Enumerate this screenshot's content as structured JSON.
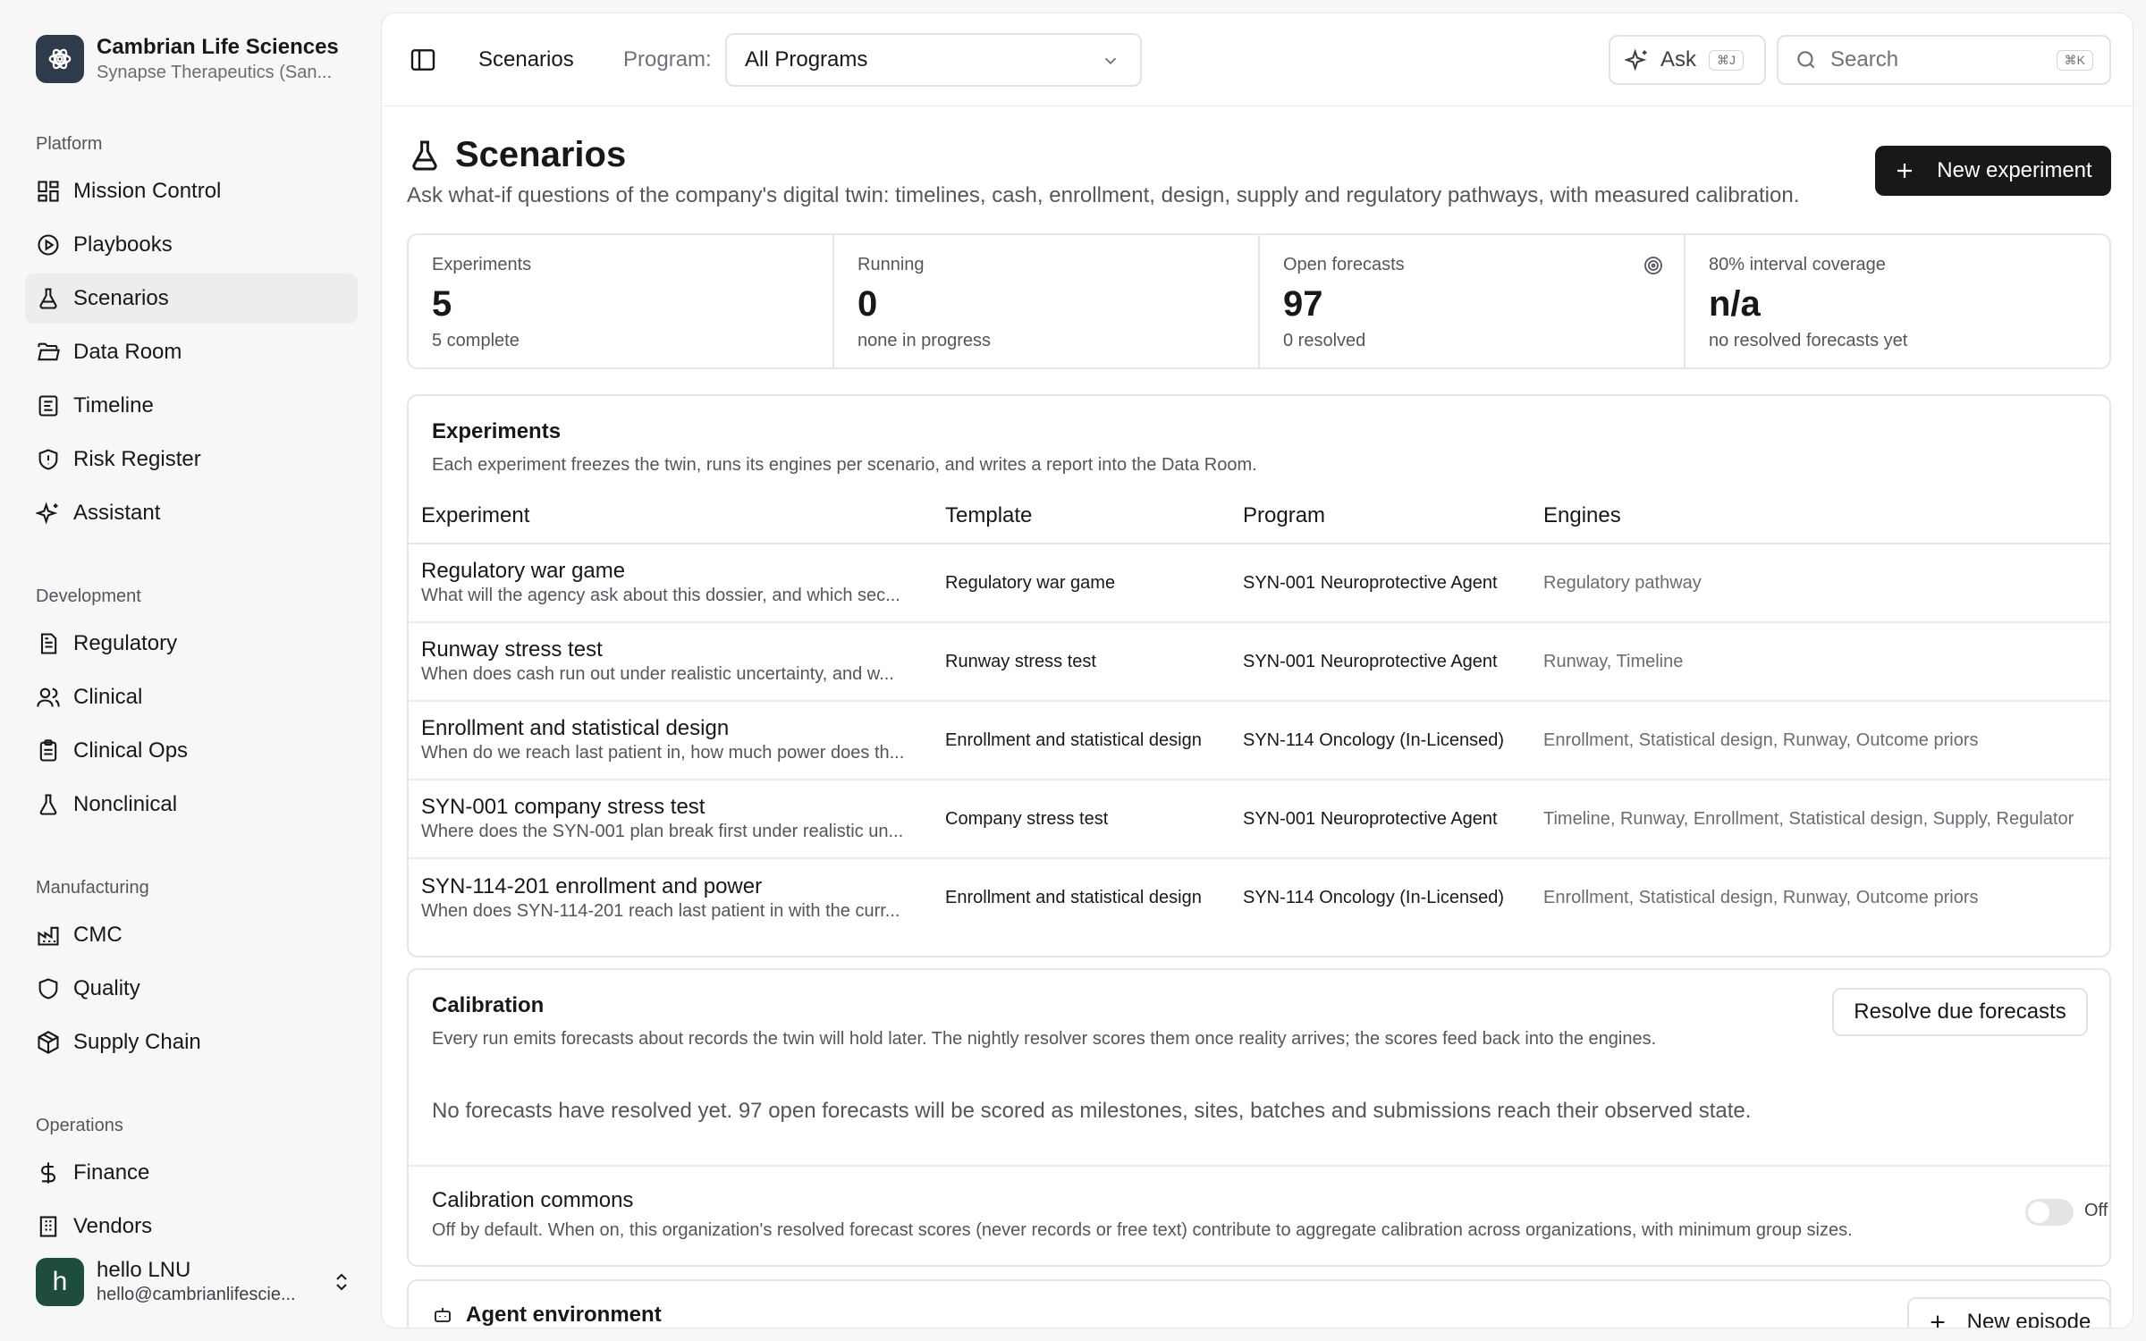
{
  "org": {
    "name": "Cambrian Life Sciences",
    "subtitle": "Synapse Therapeutics (San..."
  },
  "sidebar": {
    "sections": [
      {
        "heading": "Platform",
        "items": [
          {
            "label": "Mission Control",
            "icon": "dashboard-icon"
          },
          {
            "label": "Playbooks",
            "icon": "play-circle-icon"
          },
          {
            "label": "Scenarios",
            "icon": "flask-icon",
            "active": true
          },
          {
            "label": "Data Room",
            "icon": "folder-open-icon"
          },
          {
            "label": "Timeline",
            "icon": "timeline-icon"
          },
          {
            "label": "Risk Register",
            "icon": "shield-alert-icon"
          },
          {
            "label": "Assistant",
            "icon": "sparkles-icon"
          }
        ]
      },
      {
        "heading": "Development",
        "items": [
          {
            "label": "Regulatory",
            "icon": "document-icon"
          },
          {
            "label": "Clinical",
            "icon": "users-icon"
          },
          {
            "label": "Clinical Ops",
            "icon": "clipboard-icon"
          },
          {
            "label": "Nonclinical",
            "icon": "beaker-icon"
          }
        ]
      },
      {
        "heading": "Manufacturing",
        "items": [
          {
            "label": "CMC",
            "icon": "factory-icon"
          },
          {
            "label": "Quality",
            "icon": "shield-icon"
          },
          {
            "label": "Supply Chain",
            "icon": "package-icon"
          }
        ]
      },
      {
        "heading": "Operations",
        "items": [
          {
            "label": "Finance",
            "icon": "dollar-icon"
          },
          {
            "label": "Vendors",
            "icon": "building-icon"
          }
        ]
      }
    ]
  },
  "user": {
    "initial": "h",
    "name": "hello LNU",
    "email": "hello@cambrianlifescie..."
  },
  "topbar": {
    "crumb": "Scenarios",
    "program_label": "Program:",
    "program_value": "All Programs",
    "ask_label": "Ask",
    "ask_kbd": "⌘J",
    "search_placeholder": "Search",
    "search_kbd": "⌘K"
  },
  "page": {
    "title": "Scenarios",
    "description": "Ask what-if questions of the company's digital twin: timelines, cash, enrollment, design, supply and regulatory pathways, with measured calibration.",
    "new_experiment": "New experiment"
  },
  "stats": [
    {
      "label": "Experiments",
      "value": "5",
      "sub": "5 complete"
    },
    {
      "label": "Running",
      "value": "0",
      "sub": "none in progress"
    },
    {
      "label": "Open forecasts",
      "value": "97",
      "sub": "0 resolved"
    },
    {
      "label": "80% interval coverage",
      "value": "n/a",
      "sub": "no resolved forecasts yet"
    }
  ],
  "experiments": {
    "title": "Experiments",
    "subtitle": "Each experiment freezes the twin, runs its engines per scenario, and writes a report into the Data Room.",
    "columns": [
      "Experiment",
      "Template",
      "Program",
      "Engines"
    ],
    "rows": [
      {
        "name": "Regulatory war game",
        "desc": "What will the agency ask about this dossier, and which sec...",
        "template": "Regulatory war game",
        "program": "SYN-001 Neuroprotective Agent",
        "engines": "Regulatory pathway"
      },
      {
        "name": "Runway stress test",
        "desc": "When does cash run out under realistic uncertainty, and w...",
        "template": "Runway stress test",
        "program": "SYN-001 Neuroprotective Agent",
        "engines": "Runway, Timeline"
      },
      {
        "name": "Enrollment and statistical design",
        "desc": "When do we reach last patient in, how much power does th...",
        "template": "Enrollment and statistical design",
        "program": "SYN-114 Oncology (In-Licensed)",
        "engines": "Enrollment, Statistical design, Runway, Outcome priors"
      },
      {
        "name": "SYN-001 company stress test",
        "desc": "Where does the SYN-001 plan break first under realistic un...",
        "template": "Company stress test",
        "program": "SYN-001 Neuroprotective Agent",
        "engines": "Timeline, Runway, Enrollment, Statistical design, Supply, Regulator"
      },
      {
        "name": "SYN-114-201 enrollment and power",
        "desc": "When does SYN-114-201 reach last patient in with the curr...",
        "template": "Enrollment and statistical design",
        "program": "SYN-114 Oncology (In-Licensed)",
        "engines": "Enrollment, Statistical design, Runway, Outcome priors"
      }
    ]
  },
  "calibration": {
    "title": "Calibration",
    "subtitle": "Every run emits forecasts about records the twin will hold later. The nightly resolver scores them once reality arrives; the scores feed back into the engines.",
    "resolve_button": "Resolve due forecasts",
    "empty_text": "No forecasts have resolved yet. 97 open forecasts will be scored as milestones, sites, batches and submissions reach their observed state.",
    "commons_title": "Calibration commons",
    "commons_desc": "Off by default. When on, this organization's resolved forecast scores (never records or free text) contribute to aggregate calibration across organizations, with minimum group sizes.",
    "toggle_label": "Off",
    "toggle_on": false
  },
  "agent": {
    "title": "Agent environment",
    "new_episode": "New episode"
  }
}
